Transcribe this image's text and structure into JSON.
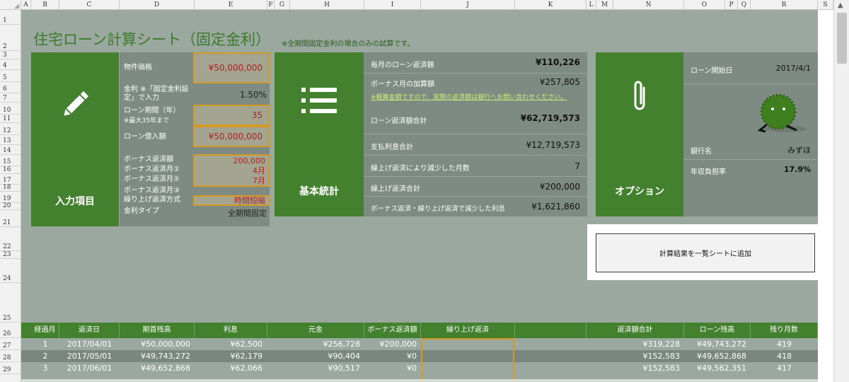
{
  "column_headers": [
    "A",
    "B",
    "C",
    "D",
    "E",
    "F",
    "G",
    "H",
    "I",
    "J",
    "K",
    "L",
    "M",
    "N",
    "O",
    "P",
    "Q",
    "R",
    "S"
  ],
  "row_headers": [
    "1",
    "2",
    "3",
    "4",
    "5",
    "6",
    "7",
    "10",
    "11",
    "12",
    "13",
    "14",
    "15",
    "16",
    "17",
    "18",
    "19",
    "20",
    "21",
    "22",
    "23",
    "24",
    "25",
    "26",
    "27",
    "28",
    "29"
  ],
  "title": "住宅ローン計算シート（固定金利）",
  "subtitle": "※全期間固定金利の場合のみの試算です。",
  "input_section": {
    "label": "入力項目",
    "icon": "pencil-icon",
    "property_price": {
      "label": "物件価格",
      "value": "¥50,000,000"
    },
    "interest_rate": {
      "label": "金利 ※「固定金利設定」で入力",
      "value": "1.50%"
    },
    "loan_period": {
      "label": "ローン期間（年）",
      "note": "※最大35年まで",
      "value": "35"
    },
    "loan_amount": {
      "label": "ローン借入額",
      "value": "¥50,000,000"
    },
    "bonus_repayment": {
      "label": "ボーナス返済額",
      "value": "200,000"
    },
    "bonus_month1": {
      "label": "ボーナス返済月①",
      "value": "4月"
    },
    "bonus_month2": {
      "label": "ボーナス返済月②",
      "value": "7月"
    },
    "bonus_month3": {
      "label": "ボーナス返済月③",
      "value": ""
    },
    "prepay_method": {
      "label": "繰り上げ返済方式",
      "value": "時間短縮"
    },
    "rate_type": {
      "label": "金利タイプ",
      "value": "全期間固定"
    }
  },
  "stats_section": {
    "label": "基本統計",
    "icon": "list-icon",
    "monthly_payment": {
      "label": "毎月のローン返済額",
      "value": "¥110,226"
    },
    "bonus_add": {
      "label": "ボーナス月の加算額",
      "value": "¥257,805"
    },
    "note": "※概算金額ですので、実際の返済額は銀行へお問い合わせください。",
    "total_repayment": {
      "label": "ローン返済額合計",
      "value": "¥62,719,573"
    },
    "total_interest": {
      "label": "支払利息合計",
      "value": "¥12,719,573"
    },
    "months_reduced": {
      "label": "繰上げ返済により減少した月数",
      "value": "7"
    },
    "prepay_total": {
      "label": "繰上げ返済合計",
      "value": "¥200,000"
    },
    "interest_reduced": {
      "label": "ボーナス返済・繰り上げ返済で減少した利息",
      "value": "¥1,621,860"
    }
  },
  "options_section": {
    "label": "オプション",
    "icon": "paperclip-icon",
    "start_date": {
      "label": "ローン開始日",
      "value": "2017/4/1"
    },
    "bank": {
      "label": "銀行名",
      "value": "みずほ"
    },
    "burden_ratio": {
      "label": "年収負担率",
      "value": "17.9%"
    }
  },
  "add_button_label": "計算結果を一覧シートに追加",
  "table": {
    "headers": [
      "経過月",
      "返済日",
      "期首残高",
      "利息",
      "元金",
      "ボーナス返済額",
      "繰り上げ返済",
      "",
      "返済額合計",
      "ローン残高",
      "残り月数"
    ],
    "rows": [
      [
        "1",
        "2017/04/01",
        "¥50,000,000",
        "¥62,500",
        "¥256,728",
        "¥200,000",
        "",
        "",
        "¥319,228",
        "¥49,743,272",
        "419"
      ],
      [
        "2",
        "2017/05/01",
        "¥49,743,272",
        "¥62,179",
        "¥90,404",
        "¥0",
        "",
        "",
        "¥152,583",
        "¥49,652,868",
        "418"
      ],
      [
        "3",
        "2017/06/01",
        "¥49,652,868",
        "¥62,066",
        "¥90,517",
        "¥0",
        "",
        "",
        "¥152,583",
        "¥49,562,351",
        "417"
      ]
    ]
  }
}
